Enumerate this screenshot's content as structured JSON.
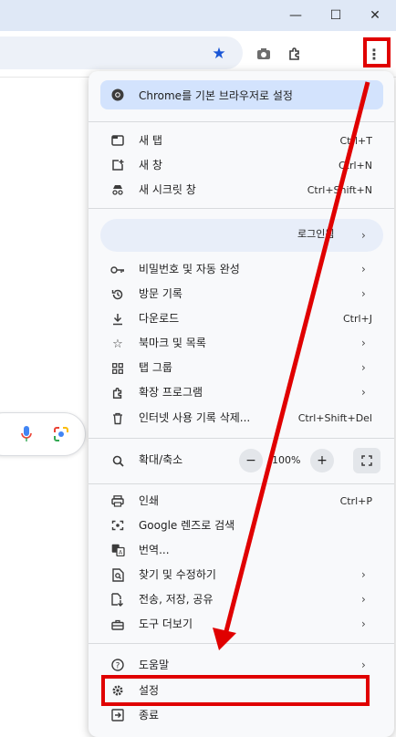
{
  "window_controls": {
    "minimize": "—",
    "maximize": "☐",
    "close": "✕"
  },
  "toolbar": {
    "bookmark_star": "★",
    "camera_icon": "camera-icon",
    "extensions_icon": "puzzle-icon",
    "menu_icon": "⋮"
  },
  "menu": {
    "set_default": "Chrome를 기본 브라우저로 설정",
    "new_tab": {
      "label": "새 탭",
      "shortcut": "Ctrl+T"
    },
    "new_window": {
      "label": "새 창",
      "shortcut": "Ctrl+N"
    },
    "new_incognito": {
      "label": "새 시크릿 창",
      "shortcut": "Ctrl+Shift+N"
    },
    "login": "로그인됨",
    "passwords": {
      "label": "비밀번호 및 자동 완성"
    },
    "history": {
      "label": "방문 기록"
    },
    "downloads": {
      "label": "다운로드",
      "shortcut": "Ctrl+J"
    },
    "bookmarks": {
      "label": "북마크 및 목록"
    },
    "tab_groups": {
      "label": "탭 그룹"
    },
    "extensions": {
      "label": "확장 프로그램"
    },
    "clear_data": {
      "label": "인터넷 사용 기록 삭제...",
      "shortcut": "Ctrl+Shift+Del"
    },
    "zoom": {
      "label": "확대/축소",
      "minus": "−",
      "value": "100%",
      "plus": "+"
    },
    "print": {
      "label": "인쇄",
      "shortcut": "Ctrl+P"
    },
    "lens": {
      "label": "Google 렌즈로 검색"
    },
    "translate": {
      "label": "번역..."
    },
    "find_edit": {
      "label": "찾기 및 수정하기"
    },
    "cast_save_share": {
      "label": "전송, 저장, 공유"
    },
    "more_tools": {
      "label": "도구 더보기"
    },
    "help": {
      "label": "도움말"
    },
    "settings": {
      "label": "설정"
    },
    "exit": {
      "label": "종료"
    },
    "arrow": "›"
  },
  "annotation": {
    "color": "#e00000"
  }
}
